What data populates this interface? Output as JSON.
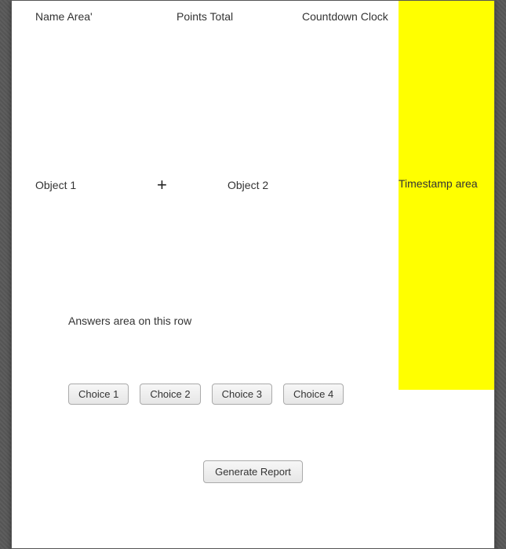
{
  "header": {
    "name_area": "Name Area'",
    "points_total": "Points Total",
    "countdown": "Countdown Clock"
  },
  "objects": {
    "object1": "Object 1",
    "plus": "+",
    "object2": "Object 2"
  },
  "timestamp": {
    "label": "Timestamp area"
  },
  "answers": {
    "label": "Answers area on this row"
  },
  "choices": {
    "c1": "Choice 1",
    "c2": "Choice 2",
    "c3": "Choice 3",
    "c4": "Choice 4"
  },
  "actions": {
    "generate_report": "Generate Report"
  },
  "colors": {
    "timestamp_bg": "#ffff00"
  }
}
